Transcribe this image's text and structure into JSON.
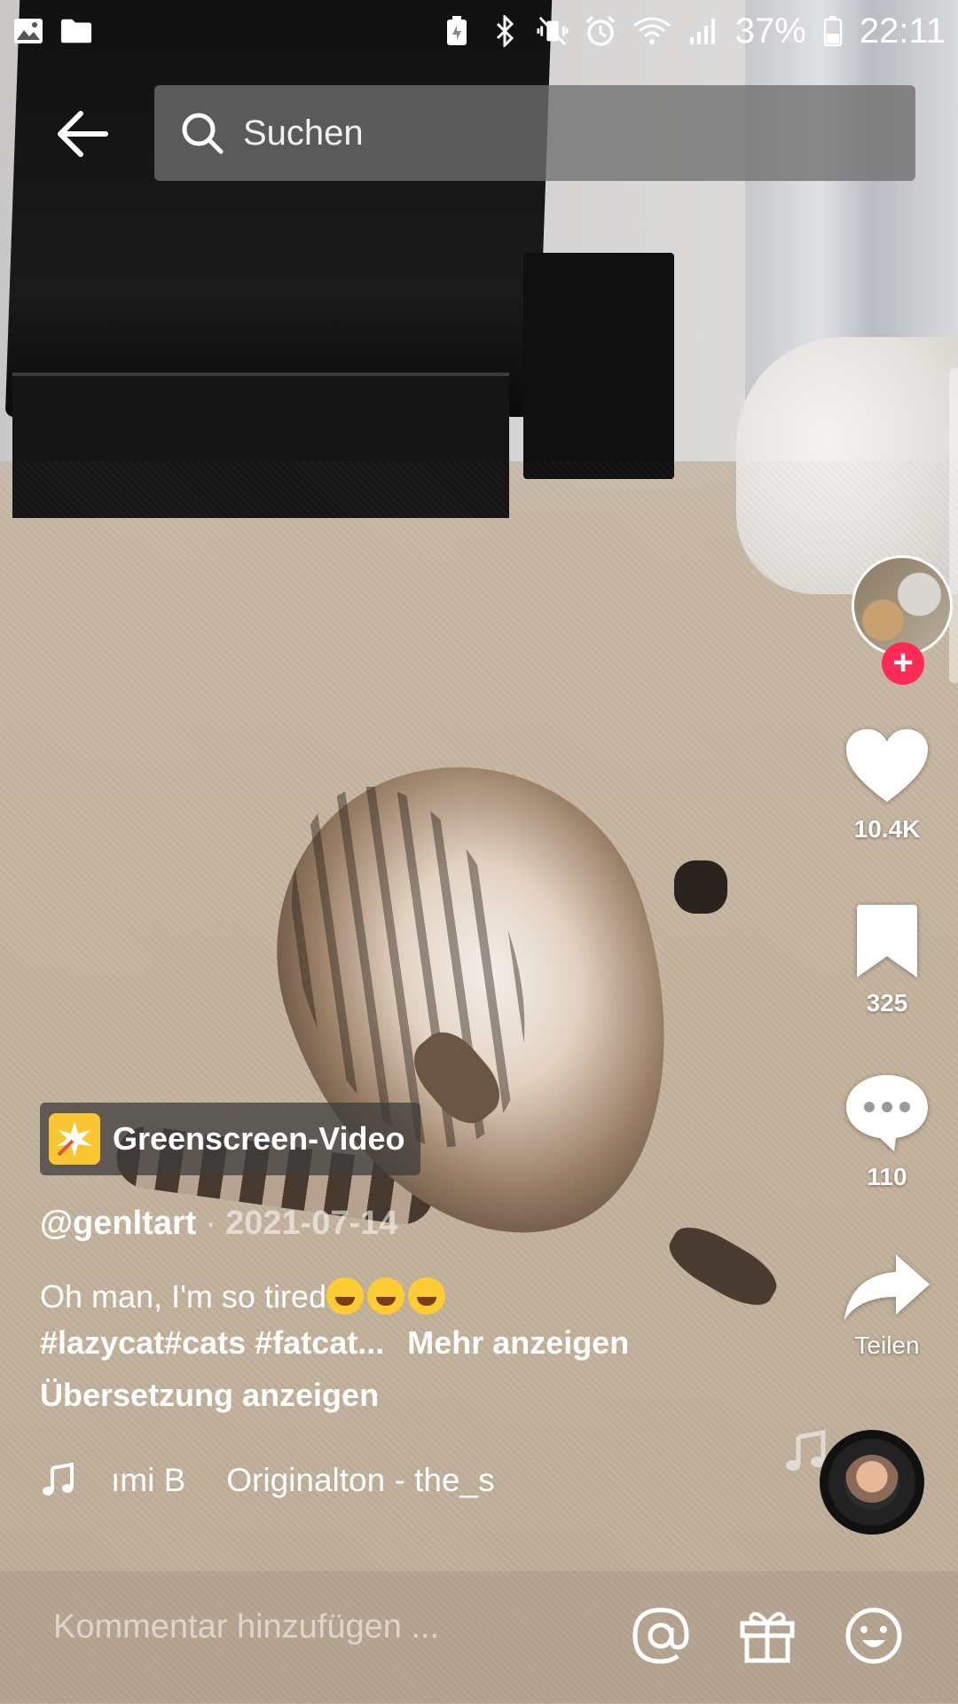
{
  "status_bar": {
    "battery_percent": "37%",
    "time": "22:11",
    "left_icons": [
      "gallery-icon",
      "folder-icon"
    ],
    "right_icons": [
      "battery-saver-icon",
      "bluetooth-icon",
      "vibrate-off-icon",
      "alarm-icon",
      "wifi-icon",
      "signal-icon",
      "battery-icon"
    ]
  },
  "search": {
    "placeholder": "Suchen"
  },
  "actions": {
    "likes": "10.4K",
    "saves": "325",
    "comments": "110",
    "share_label": "Teilen"
  },
  "effect": {
    "label": "Greenscreen-Video"
  },
  "post": {
    "author": "@genltart",
    "date": "2021-07-14",
    "caption_text": "Oh man, I'm so tired",
    "hashtags": "#lazycat#cats #fatcat...",
    "more_label": "Mehr anzeigen",
    "translate_label": "Übersetzung anzeigen"
  },
  "music": {
    "owner": "ımi B",
    "title": "Originalton - the_s"
  },
  "comment_bar": {
    "placeholder": "Kommentar hinzufügen ..."
  },
  "colors": {
    "accent": "#fe2c55",
    "effect_badge": "#f9c631"
  }
}
